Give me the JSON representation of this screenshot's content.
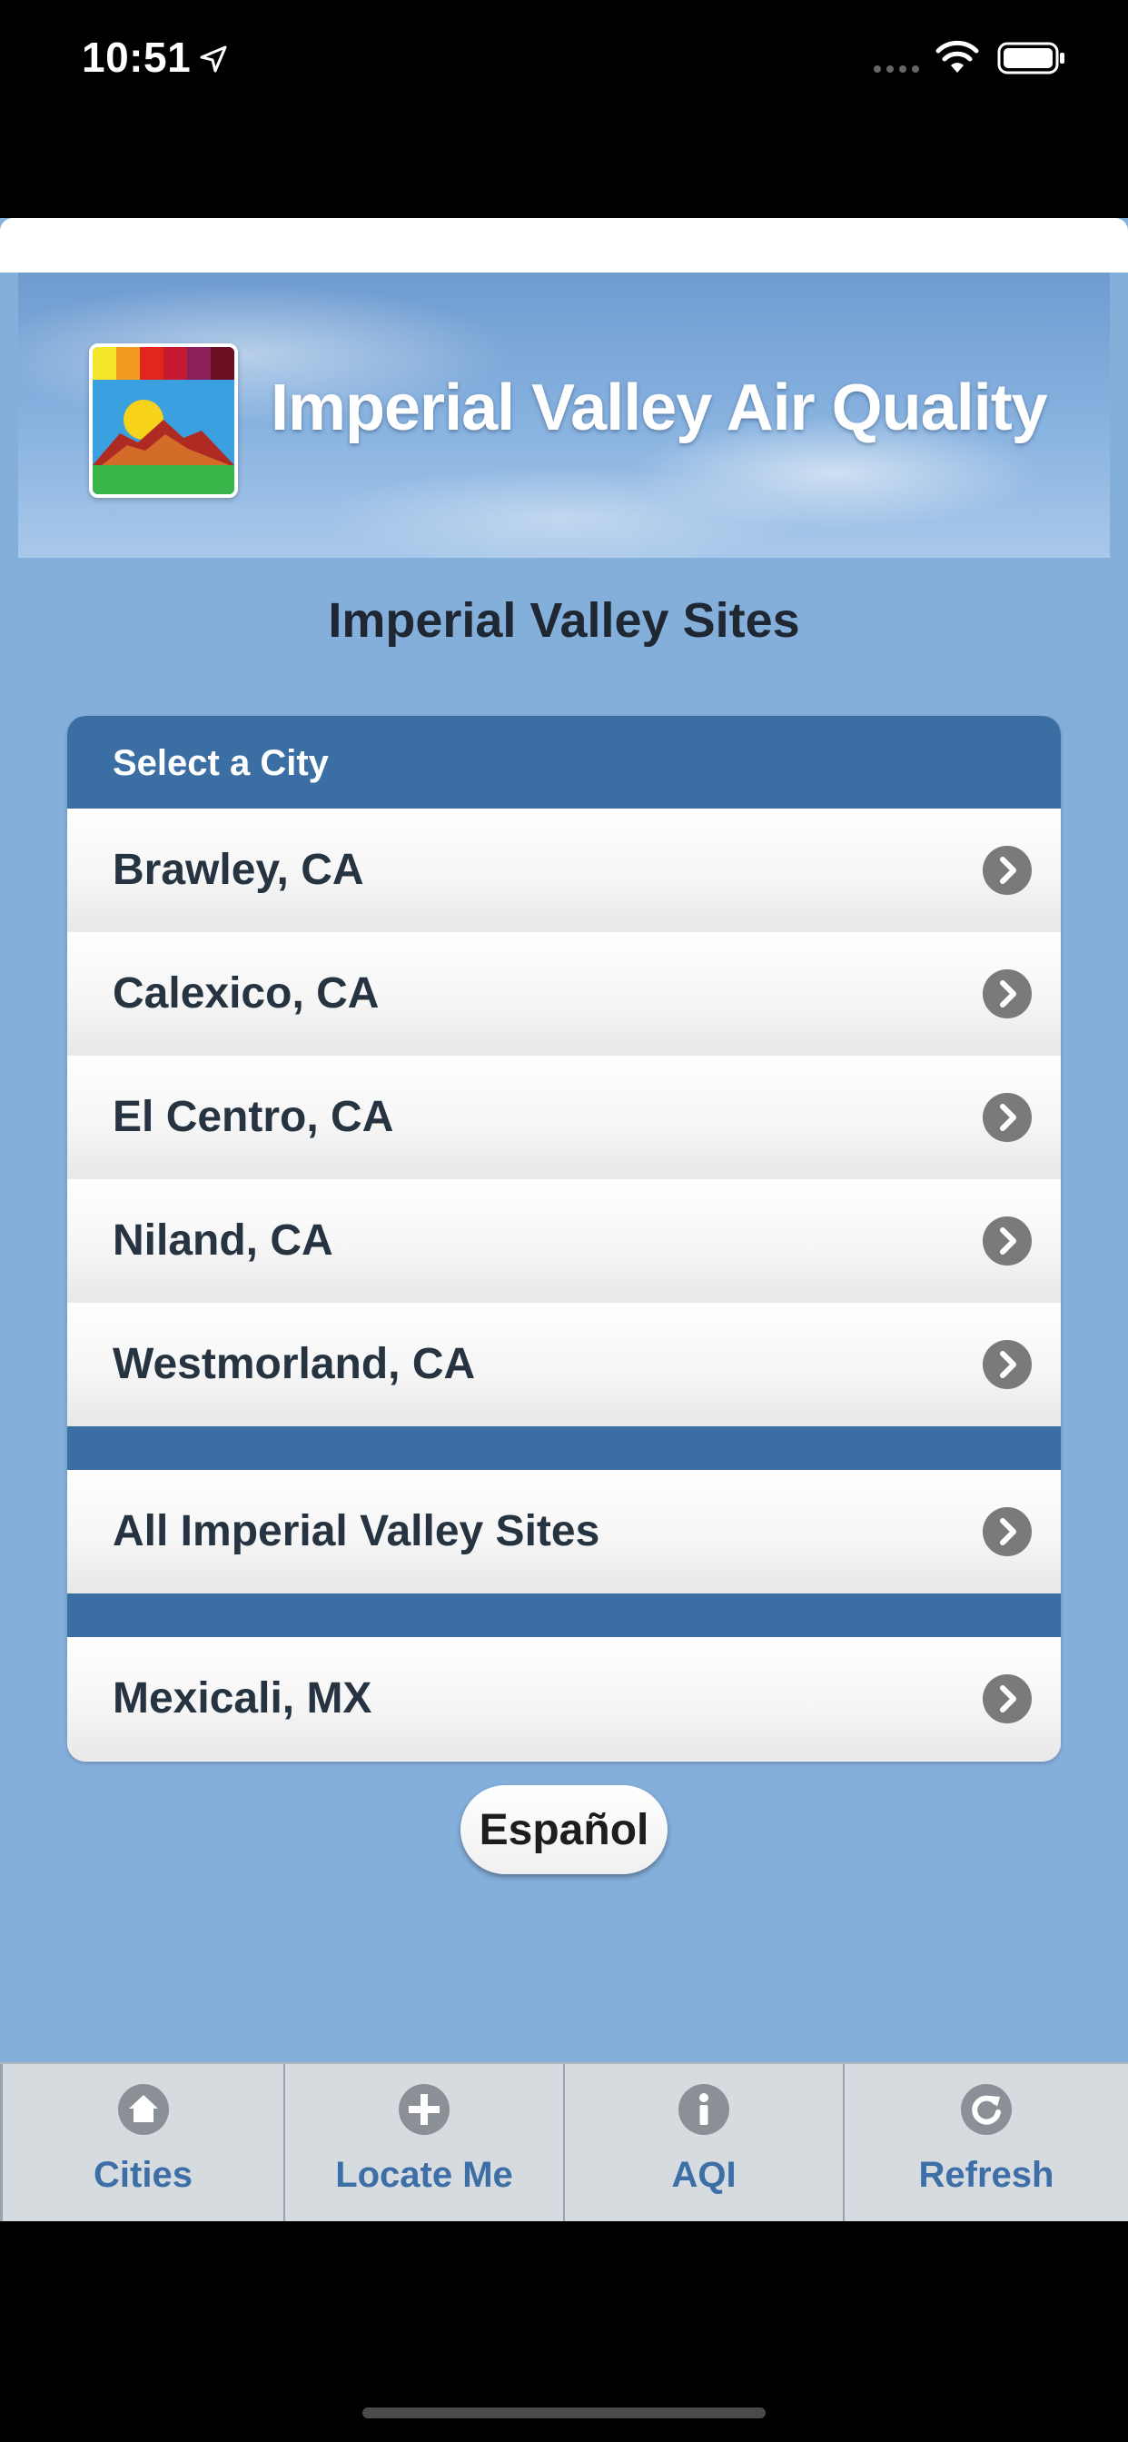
{
  "status_bar": {
    "time": "10:51"
  },
  "banner": {
    "title": "Imperial Valley Air Quality"
  },
  "page": {
    "title": "Imperial Valley Sites"
  },
  "list": {
    "header": "Select a City",
    "cities": [
      "Brawley, CA",
      "Calexico, CA",
      "El Centro, CA",
      "Niland, CA",
      "Westmorland, CA"
    ],
    "all_sites": "All Imperial Valley Sites",
    "mexico": "Mexicali, MX"
  },
  "language_button": "Español",
  "tabs": [
    {
      "label": "Cities",
      "icon": "home-icon"
    },
    {
      "label": "Locate Me",
      "icon": "plus-icon"
    },
    {
      "label": "AQI",
      "icon": "info-icon"
    },
    {
      "label": "Refresh",
      "icon": "refresh-icon"
    }
  ],
  "colors": {
    "background": "#84afdb",
    "header_blue": "#3b6fa4",
    "tab_text": "#3d6fa6"
  }
}
